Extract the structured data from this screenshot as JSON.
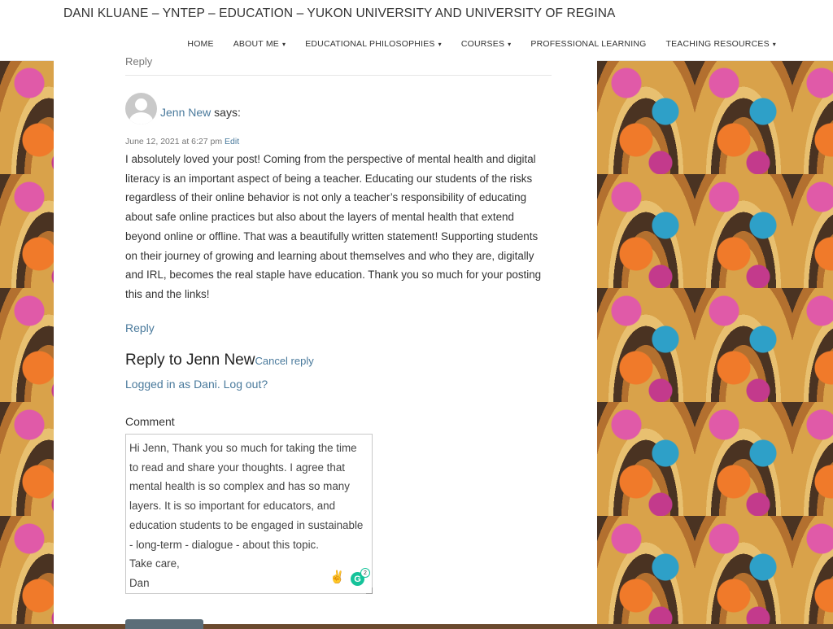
{
  "header": {
    "site_title": "DANI KLUANE – YNTEP – EDUCATION – YUKON UNIVERSITY AND UNIVERSITY OF REGINA",
    "nav": [
      {
        "label": "HOME"
      },
      {
        "label": "ABOUT ME",
        "caret": "▾"
      },
      {
        "label": "EDUCATIONAL PHILOSOPHIES",
        "caret": "▾"
      },
      {
        "label": "COURSES",
        "caret": "▾"
      },
      {
        "label": "PROFESSIONAL LEARNING"
      },
      {
        "label": "TEACHING RESOURCES",
        "caret": "▾"
      }
    ]
  },
  "comment": {
    "top_fragment": "Reply",
    "author": "Jenn New",
    "says": "says:",
    "date": "June 12, 2021 at 6:27 pm",
    "edit": "Edit",
    "body": "I absolutely loved your post! Coming from the perspective of mental health and digital literacy is an important aspect of being a teacher. Educating our students of the risks regardless of their online behavior is not only a teacher’s responsibility of educating about safe online practices but also about the layers of mental health that extend beyond online or offline. That was a beautifully written statement! Supporting students on their journey of growing and learning about themselves and who they are, digitally and IRL, becomes the real staple have education. Thank you so much for your posting this and the links!",
    "reply": "Reply"
  },
  "reply_form": {
    "title": "Reply to Jenn New",
    "cancel": "Cancel reply",
    "logged_in": "Logged in as Dani. Log out?",
    "comment_label": "Comment",
    "comment_value": "Hi Jenn, Thank you so much for taking the time to read and share your thoughts. I agree that mental health is so complex and has so many layers. It is so important for educators, and education students to be engaged in sustainable - long-term - dialogue - about this topic.\nTake care,\nDan",
    "emoji": "✌️",
    "grammarly_letter": "G",
    "grammarly_count": "2"
  },
  "colors": {
    "link": "#4a7a9c",
    "grammarly": "#15c39a",
    "button": "#5b6d78"
  }
}
